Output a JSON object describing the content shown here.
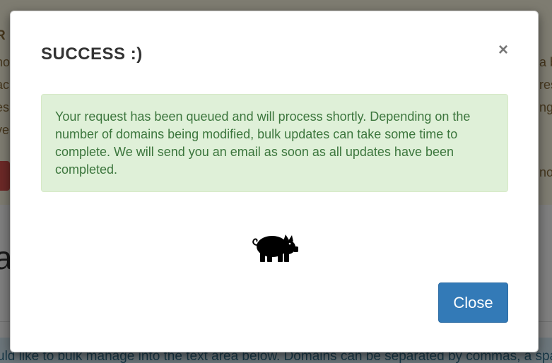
{
  "background": {
    "alert_title_fragment": "R",
    "line_fragments": [
      "no",
      "ac",
      "es",
      "ve"
    ],
    "right_fragments": [
      "a b",
      "res",
      "ng"
    ],
    "button_fragment": "no",
    "heading_fragment": "a",
    "instruction_text": "uld like to bulk manage into the text area below. Domains can be separated by commas, a spac"
  },
  "modal": {
    "title": "SUCCESS :)",
    "close_symbol": "×",
    "message": "Your request has been queued and will process shortly. Depending on the number of domains being modified, bulk updates can take some time to complete. We will send you an email as soon as all updates have been completed.",
    "icon": "pig-icon",
    "close_button_label": "Close"
  },
  "colors": {
    "success_bg": "#dff0d8",
    "success_text": "#3c763d",
    "primary_button": "#337ab7",
    "warning_text": "#8a6d3b"
  }
}
